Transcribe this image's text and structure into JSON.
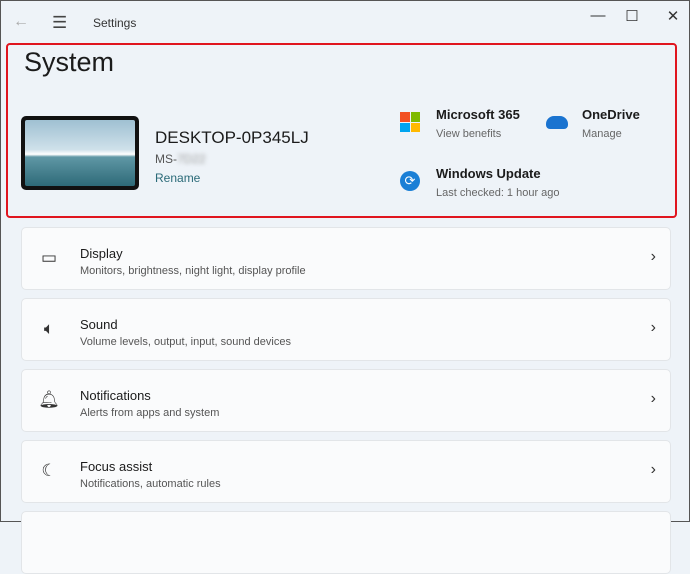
{
  "titlebar": {
    "title": "Settings"
  },
  "header": {
    "title": "System",
    "device_name": "DESKTOP-0P345LJ",
    "model_prefix": "MS-",
    "model_blurred": "7D22",
    "rename": "Rename"
  },
  "quick_links": [
    {
      "label": "Microsoft 365",
      "sub": "View benefits"
    },
    {
      "label": "OneDrive",
      "sub": "Manage"
    },
    {
      "label": "Windows Update",
      "sub": "Last checked: 1 hour ago"
    }
  ],
  "items": [
    {
      "title": "Display",
      "sub": "Monitors, brightness, night light, display profile",
      "icon": "monitor-icon"
    },
    {
      "title": "Sound",
      "sub": "Volume levels, output, input, sound devices",
      "icon": "speaker-icon"
    },
    {
      "title": "Notifications",
      "sub": "Alerts from apps and system",
      "icon": "bell-icon"
    },
    {
      "title": "Focus assist",
      "sub": "Notifications, automatic rules",
      "icon": "moon-icon"
    }
  ],
  "colors": {
    "highlight": "#e0141e",
    "accent": "#1a7fd6"
  }
}
